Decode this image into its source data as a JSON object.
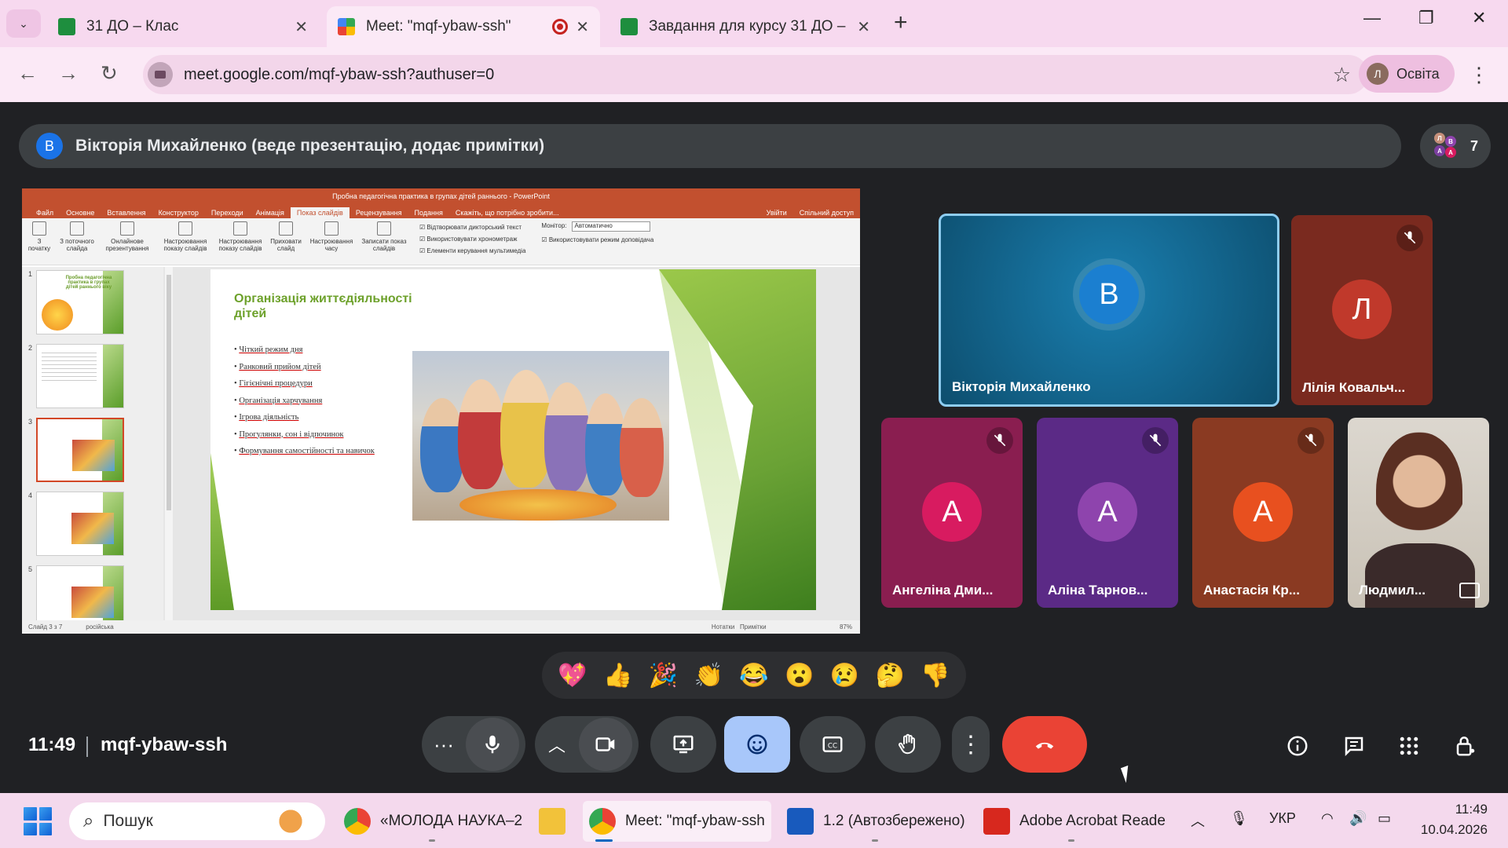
{
  "browser": {
    "tabs": [
      {
        "title": "31 ДО – Клас",
        "active": false
      },
      {
        "title": "Meet: \"mqf-ybaw-ssh\"",
        "active": true
      },
      {
        "title": "Завдання для курсу 31 ДО – К",
        "active": false
      }
    ],
    "url": "meet.google.com/mqf-ybaw-ssh?authuser=0",
    "profile_initial": "Л",
    "profile_name": "Освіта"
  },
  "meet": {
    "presenter_initial": "В",
    "presenter_banner": "Вікторія Михайленко (веде презентацію, додає примітки)",
    "participants_count": "7",
    "meeting_time": "11:49",
    "meeting_code": "mqf-ybaw-ssh",
    "tiles": [
      {
        "initial": "В",
        "name": "Вікторія Михайленко",
        "muted": false,
        "speaking": true
      },
      {
        "initial": "Л",
        "name": "Лілія Ковальч...",
        "muted": true
      },
      {
        "initial": "А",
        "name": "Ангеліна Дми...",
        "muted": true
      },
      {
        "initial": "А",
        "name": "Аліна Тарнов...",
        "muted": true
      },
      {
        "initial": "А",
        "name": "Анастасія Кр...",
        "muted": true
      },
      {
        "initial": "",
        "name": "Людмил...",
        "muted": false
      }
    ],
    "reactions": [
      "💖",
      "👍",
      "🎉",
      "👏",
      "😂",
      "😮",
      "😢",
      "🤔",
      "👎"
    ],
    "colors": {
      "accent_blue": "#a8c7fa",
      "end_call": "#ea4335",
      "tile_pink": "#8a1e50",
      "tile_purple": "#5b2a86",
      "tile_orange": "#8a3a22"
    }
  },
  "powerpoint": {
    "title": "Пробна педагогічна практика в групах дітей раннього - PowerPoint",
    "menu": [
      "Файл",
      "Основне",
      "Вставлення",
      "Конструктор",
      "Переходи",
      "Анімація",
      "Показ слайдів",
      "Рецензування",
      "Подання",
      "Скажіть, що потрібно зробити..."
    ],
    "active_menu": "Показ слайдів",
    "signin": "Увійти",
    "share": "Спільний доступ",
    "ribbon_buttons": [
      "З початку",
      "З поточного слайда",
      "Онлайнове презентування",
      "Настроювання показу слайдів",
      "Настроювання показу слайдів",
      "Приховати слайд",
      "Настроювання часу",
      "Записати показ слайдів"
    ],
    "ribbon_checks": [
      "Відтворювати дикторський текст",
      "Використовувати хронометраж",
      "Елементи керування мультимедіа"
    ],
    "monitor_label": "Монітор:",
    "monitor_value": "Автоматично",
    "presenter_view": "Використовувати режим доповідача",
    "slide_title": "Організація життєдіяльності дітей",
    "bullets": [
      "Чіткий режим дня",
      "Ранковий прийом дітей",
      "Гігієнічні процедури",
      "Організація харчування",
      "Ігрова діяльність",
      "Прогулянки, сон і відпочинок",
      "Формування самостійності та навичок"
    ],
    "thumb_title": "Пробна педагогічна практика в групах дітей раннього віку",
    "status_left": "Слайд 3 з 7",
    "status_lang": "російська",
    "status_notes": "Нотатки",
    "status_comments": "Примітки",
    "zoom": "87%"
  },
  "taskbar": {
    "search_placeholder": "Пошук",
    "apps": [
      {
        "label": "«МОЛОДА НАУКА–2"
      },
      {
        "label": ""
      },
      {
        "label": "Meet: \"mqf-ybaw-ssh"
      },
      {
        "label": "1.2 (Автозбережено)"
      },
      {
        "label": "Adobe Acrobat Reade"
      }
    ],
    "language": "УКР",
    "time": "11:49",
    "date": "10.04.2026"
  }
}
